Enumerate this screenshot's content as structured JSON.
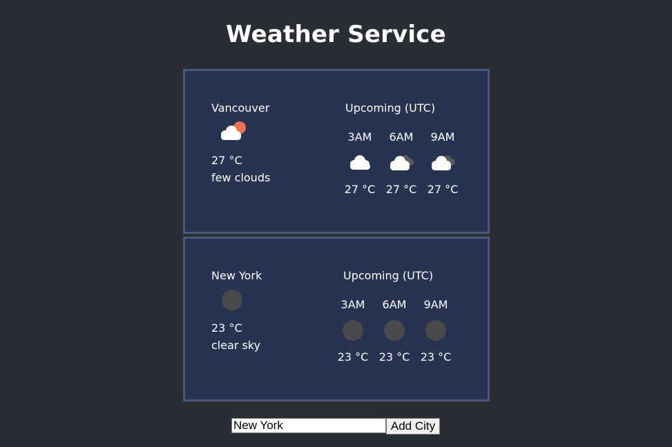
{
  "page": {
    "title": "Weather Service"
  },
  "cities": [
    {
      "name": "Vancouver",
      "current": {
        "icon": "few-clouds-day-icon",
        "temp": "27 °C",
        "description": "few clouds"
      },
      "upcoming_title": "Upcoming (UTC)",
      "upcoming": [
        {
          "time": "3AM",
          "icon": "cloud-icon",
          "temp": "27 °C"
        },
        {
          "time": "6AM",
          "icon": "cloud-overcast-icon",
          "temp": "27 °C"
        },
        {
          "time": "9AM",
          "icon": "cloud-overcast-icon",
          "temp": "27 °C"
        }
      ]
    },
    {
      "name": "New York",
      "current": {
        "icon": "clear-night-icon",
        "temp": "23 °C",
        "description": "clear sky"
      },
      "upcoming_title": "Upcoming (UTC)",
      "upcoming": [
        {
          "time": "3AM",
          "icon": "clear-night-icon",
          "temp": "23 °C"
        },
        {
          "time": "6AM",
          "icon": "clear-night-icon",
          "temp": "23 °C"
        },
        {
          "time": "9AM",
          "icon": "clear-night-icon",
          "temp": "23 °C"
        }
      ]
    }
  ],
  "form": {
    "input_value": "New York",
    "button_label": "Add City"
  },
  "colors": {
    "background": "#292d34",
    "card": "#263351",
    "card_border": "#4a5879",
    "sun": "#f07350",
    "moon": "#4a4a4a"
  }
}
